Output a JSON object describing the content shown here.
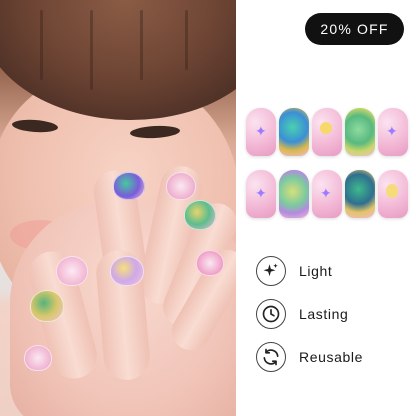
{
  "promo": {
    "badge_text": "20% OFF"
  },
  "features": [
    {
      "icon": "sparkle-icon",
      "label": "Light"
    },
    {
      "icon": "clock-icon",
      "label": "Lasting"
    },
    {
      "icon": "reusable-icon",
      "label": "Reusable"
    }
  ],
  "colors": {
    "badge_bg": "#111111",
    "badge_text": "#ffffff",
    "nail_pink": "#f3b9d6",
    "accent_purple": "#9c7bff"
  }
}
